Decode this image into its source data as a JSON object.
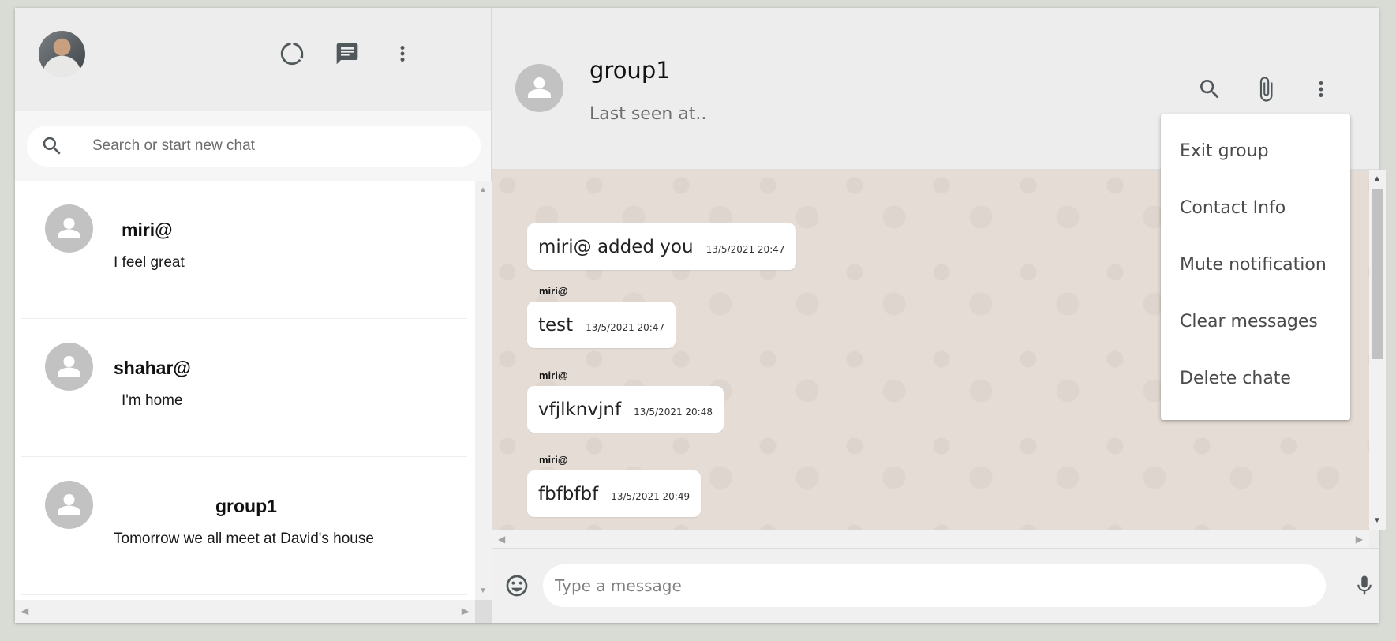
{
  "sidebar": {
    "header_icons": [
      "status-icon",
      "new-chat-icon",
      "menu-dots-icon"
    ],
    "search": {
      "placeholder": "Search or start new chat",
      "value": ""
    },
    "chats": [
      {
        "name": "miri@",
        "last_message": "I feel great"
      },
      {
        "name": "shahar@",
        "last_message": "I'm home"
      },
      {
        "name": "group1",
        "last_message": "Tomorrow we all meet at David's house"
      }
    ]
  },
  "conversation": {
    "title": "group1",
    "subtitle": "Last seen at..",
    "header_icons": [
      "search-icon",
      "attach-icon",
      "menu-dots-icon"
    ],
    "messages": [
      {
        "sender": "",
        "text": "miri@ added you",
        "time": "13/5/2021 20:47"
      },
      {
        "sender": "miri@",
        "text": "test",
        "time": "13/5/2021 20:47"
      },
      {
        "sender": "miri@",
        "text": "vfjlknvjnf",
        "time": "13/5/2021 20:48"
      },
      {
        "sender": "miri@",
        "text": "fbfbfbf",
        "time": "13/5/2021 20:49"
      }
    ],
    "composer": {
      "placeholder": "Type a message",
      "value": ""
    }
  },
  "menu": {
    "items": [
      "Exit group",
      "Contact Info",
      "Mute notification",
      "Clear messages",
      "Delete chate"
    ]
  },
  "colors": {
    "header_bg": "#ededed",
    "chat_bg": "#e5ddd5",
    "avatar_placeholder": "#c2c2c2",
    "icon": "#51585c"
  }
}
